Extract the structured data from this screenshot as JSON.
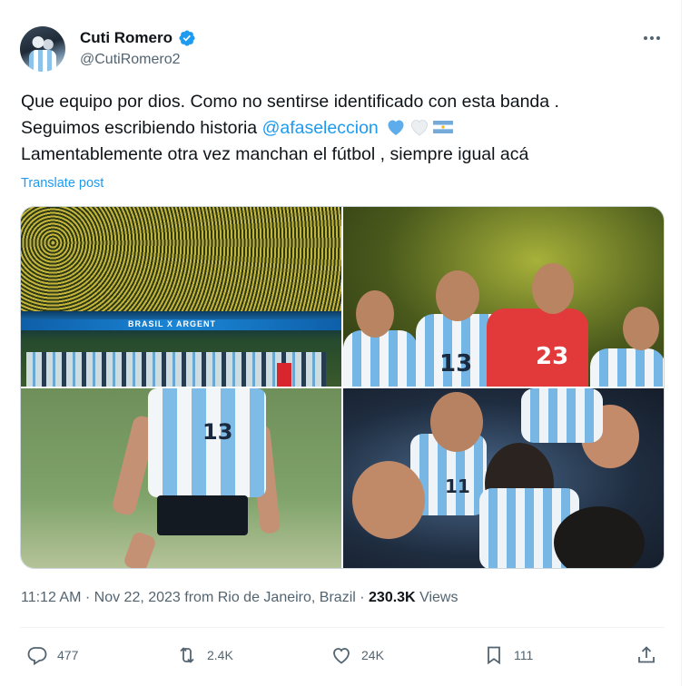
{
  "author": {
    "name": "Cuti Romero",
    "handle": "@CutiRomero2"
  },
  "post": {
    "line1": "Que equipo por dios. Como no sentirse identificado con esta banda .",
    "line2_prefix": "Seguimos escribiendo historia ",
    "mention": "@afaseleccion",
    "line3": "Lamentablemente otra vez manchan el fútbol , siempre igual acá",
    "emojis": [
      "blue-heart-emoji",
      "white-heart-emoji",
      "argentina-flag-emoji"
    ],
    "translate_label": "Translate post",
    "banner_text": "BRASIL X ARGENT",
    "jersey_numbers": [
      "13",
      "23",
      "13",
      "11"
    ]
  },
  "meta": {
    "time": "11:12 AM",
    "date": "Nov 22, 2023",
    "location": "from Rio de Janeiro, Brazil",
    "views_count": "230.3K",
    "views_label": "Views"
  },
  "actions": {
    "replies": "477",
    "reposts": "2.4K",
    "likes": "24K",
    "bookmarks": "111"
  },
  "colors": {
    "accent": "#1d9bf0",
    "text": "#0f1419",
    "muted": "#536471"
  }
}
